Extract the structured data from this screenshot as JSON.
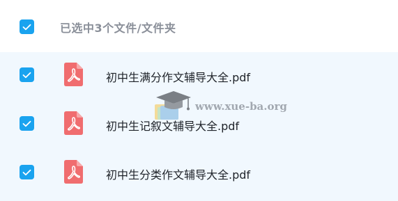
{
  "header": {
    "selection_label": "已选中3个文件/文件夹",
    "checked": true
  },
  "files": [
    {
      "name": "初中生满分作文辅导大全.pdf",
      "type": "pdf",
      "checked": true
    },
    {
      "name": "初中生记叙文辅导大全.pdf",
      "type": "pdf",
      "checked": true
    },
    {
      "name": "初中生分类作文辅导大全.pdf",
      "type": "pdf",
      "checked": true
    }
  ],
  "watermark": {
    "text": "www.xue-ba.org"
  },
  "colors": {
    "accent": "#1aa3ef",
    "pdf_icon": "#f06d6f",
    "list_background": "#f1f8fe",
    "header_text": "#8a8f99",
    "file_text": "#1f2329"
  },
  "icons": {
    "checkbox": "check-icon",
    "file": "pdf-file-icon",
    "watermark": "graduation-cap-icon"
  }
}
